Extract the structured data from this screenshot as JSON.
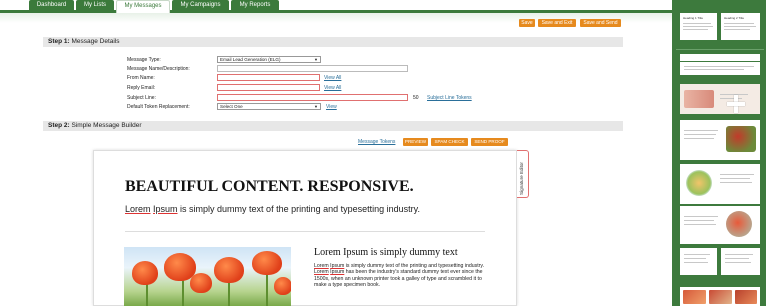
{
  "nav": {
    "tabs": [
      {
        "label": "Dashboard"
      },
      {
        "label": "My Lists"
      },
      {
        "label": "My Messages"
      },
      {
        "label": "My Campaigns"
      },
      {
        "label": "My Reports"
      }
    ]
  },
  "actions": {
    "save": "Save",
    "save_exit": "Save and Exit",
    "save_send": "Save and Send"
  },
  "step1": {
    "number": "Step 1:",
    "title": "Message Details",
    "message_type_label": "Message Type:",
    "message_type_value": "Email Lead Generation (ELG)",
    "name_label": "Message Name/Description:",
    "from_label": "From Name:",
    "reply_label": "Reply Email:",
    "subject_label": "Subject Line:",
    "token_label": "Default Token Replacement:",
    "token_value": "Select One",
    "view_all_1": "View All",
    "view_all_2": "View All",
    "subject_count": "50",
    "subject_tokens": "Subject Line Tokens",
    "view": "View"
  },
  "step2": {
    "number": "Step 2:",
    "title": "Simple Message Builder",
    "message_tokens": "Message Tokens",
    "preview": "PREVIEW",
    "spam_check": "SPAM CHECK",
    "send_proof": "SEND PROOF",
    "signature_tab": "Signature Editor"
  },
  "content": {
    "headline": "BEAUTIFUL CONTENT. RESPONSIVE.",
    "subhead_w1": "Lorem",
    "subhead_w2": "Ipsum",
    "subhead_rest": " is simply dummy text of the printing and typesetting industry.",
    "card_title": "Lorem Ipsum is simply dummy text",
    "card_w1": "Lorem",
    "card_w2": "Ipsum",
    "card_p1": " is simply dummy text of the printing and typesetting industry. ",
    "card_w3": "Lorem",
    "card_w4": "Ipsum",
    "card_p2": " has been the industry's standard dummy text ever since the 1500s, when an unknown printer took a galley of type and scrambled it to make a type specimen book."
  },
  "sidebar": {
    "thumb1_title": "Heading 1 Title",
    "thumb2_title": "Heading 2 Title"
  },
  "colors": {
    "green": "#3b7a3b",
    "orange": "#e68a1e",
    "link": "#2a6f9a"
  }
}
